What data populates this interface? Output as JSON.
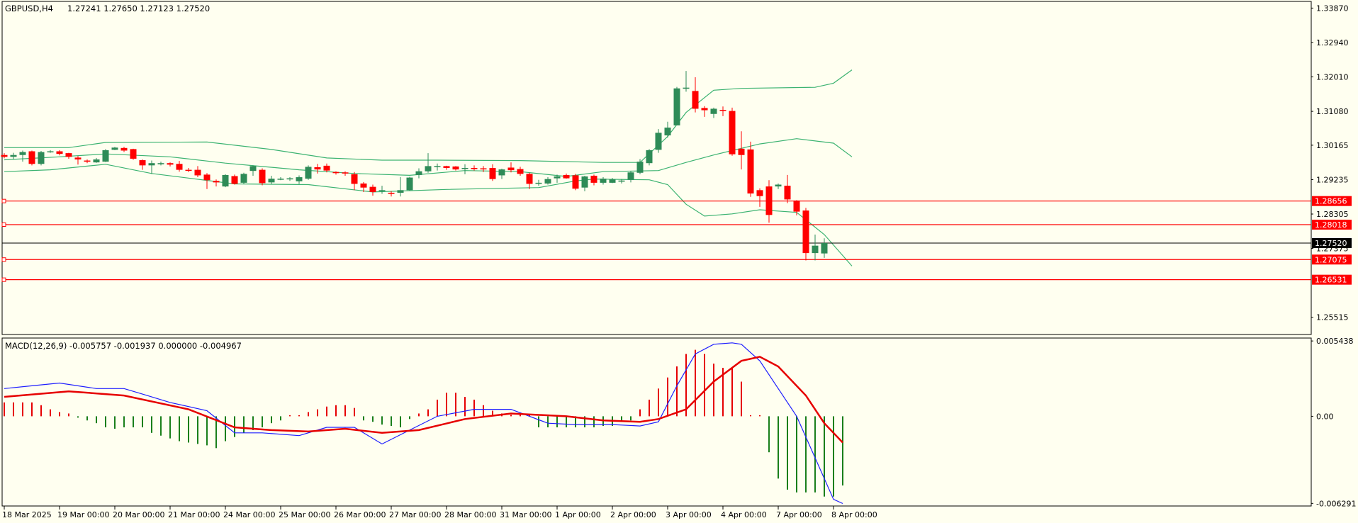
{
  "header": {
    "symbol_tf": "GBPUSD,H4",
    "ohlc": "1.27241 1.27650 1.27123 1.27520"
  },
  "macd_header": "MACD(12,26,9) -0.005757 -0.001937 0.000000 -0.004967",
  "colors": {
    "background": "#fffff0",
    "bull": "#2e8b57",
    "bear": "#ff0000",
    "bands": "#3cb371",
    "level": "#ff0000",
    "macd_line": "#1e1eff",
    "signal_line": "#e60000",
    "hist_pos": "#e60000",
    "hist_neg": "#1a7f1a"
  },
  "price_axis": {
    "ticks": [
      "1.33870",
      "1.32940",
      "1.32010",
      "1.31080",
      "1.30165",
      "1.29235",
      "1.28305",
      "1.27375",
      "1.25515"
    ],
    "levels": [
      "1.28656",
      "1.28018",
      "1.27075",
      "1.26531"
    ],
    "current": "1.27520"
  },
  "macd_axis": {
    "ticks": [
      "0.005438",
      "0.00",
      "-0.006291"
    ]
  },
  "time_axis": [
    "18 Mar 2025",
    "19 Mar 00:00",
    "20 Mar 00:00",
    "21 Mar 00:00",
    "24 Mar 00:00",
    "25 Mar 00:00",
    "26 Mar 00:00",
    "27 Mar 00:00",
    "28 Mar 00:00",
    "31 Mar 00:00",
    "1 Apr 00:00",
    "2 Apr 00:00",
    "3 Apr 00:00",
    "4 Apr 00:00",
    "7 Apr 00:00",
    "8 Apr 00:00"
  ],
  "chart_data": [
    {
      "type": "candlestick",
      "symbol": "GBPUSD",
      "timeframe": "H4",
      "ylim": [
        1.2505,
        1.3405
      ],
      "candles": [
        {
          "o": 1.299,
          "h": 1.2995,
          "l": 1.2981,
          "c": 1.2985
        },
        {
          "o": 1.2985,
          "h": 1.2996,
          "l": 1.2978,
          "c": 1.299
        },
        {
          "o": 1.299,
          "h": 1.3002,
          "l": 1.2972,
          "c": 1.2998
        },
        {
          "o": 1.3,
          "h": 1.3002,
          "l": 1.2962,
          "c": 1.2966
        },
        {
          "o": 1.2966,
          "h": 1.3001,
          "l": 1.2962,
          "c": 1.2998
        },
        {
          "o": 1.2999,
          "h": 1.3003,
          "l": 1.2996,
          "c": 1.3
        },
        {
          "o": 1.3,
          "h": 1.3003,
          "l": 1.2989,
          "c": 1.2993
        },
        {
          "o": 1.2995,
          "h": 1.2996,
          "l": 1.298,
          "c": 1.2985
        },
        {
          "o": 1.2983,
          "h": 1.2987,
          "l": 1.2964,
          "c": 1.2978
        },
        {
          "o": 1.2975,
          "h": 1.2978,
          "l": 1.2968,
          "c": 1.2972
        },
        {
          "o": 1.297,
          "h": 1.2982,
          "l": 1.2969,
          "c": 1.2978
        },
        {
          "o": 1.2972,
          "h": 1.3006,
          "l": 1.2971,
          "c": 1.3003
        },
        {
          "o": 1.3004,
          "h": 1.3012,
          "l": 1.3003,
          "c": 1.301
        },
        {
          "o": 1.3009,
          "h": 1.3012,
          "l": 1.2998,
          "c": 1.3002
        },
        {
          "o": 1.3006,
          "h": 1.3007,
          "l": 1.2977,
          "c": 1.298
        },
        {
          "o": 1.2976,
          "h": 1.2978,
          "l": 1.295,
          "c": 1.2962
        },
        {
          "o": 1.2962,
          "h": 1.2975,
          "l": 1.2939,
          "c": 1.2968
        },
        {
          "o": 1.2965,
          "h": 1.2972,
          "l": 1.2962,
          "c": 1.2968
        },
        {
          "o": 1.2968,
          "h": 1.297,
          "l": 1.2959,
          "c": 1.2964
        },
        {
          "o": 1.2966,
          "h": 1.2974,
          "l": 1.2945,
          "c": 1.295
        },
        {
          "o": 1.295,
          "h": 1.2955,
          "l": 1.2944,
          "c": 1.2948
        },
        {
          "o": 1.295,
          "h": 1.296,
          "l": 1.293,
          "c": 1.2935
        },
        {
          "o": 1.2937,
          "h": 1.2941,
          "l": 1.2898,
          "c": 1.2922
        },
        {
          "o": 1.292,
          "h": 1.2924,
          "l": 1.2905,
          "c": 1.2916
        },
        {
          "o": 1.2905,
          "h": 1.2938,
          "l": 1.2903,
          "c": 1.2936
        },
        {
          "o": 1.2933,
          "h": 1.2937,
          "l": 1.291,
          "c": 1.2912
        },
        {
          "o": 1.2915,
          "h": 1.2942,
          "l": 1.2912,
          "c": 1.2939
        },
        {
          "o": 1.2947,
          "h": 1.2962,
          "l": 1.2934,
          "c": 1.296
        },
        {
          "o": 1.295,
          "h": 1.2954,
          "l": 1.2908,
          "c": 1.2914
        },
        {
          "o": 1.2916,
          "h": 1.2934,
          "l": 1.2912,
          "c": 1.2926
        },
        {
          "o": 1.2925,
          "h": 1.293,
          "l": 1.2922,
          "c": 1.2926
        },
        {
          "o": 1.2926,
          "h": 1.293,
          "l": 1.292,
          "c": 1.2927
        },
        {
          "o": 1.2919,
          "h": 1.2935,
          "l": 1.2912,
          "c": 1.293
        },
        {
          "o": 1.2926,
          "h": 1.2962,
          "l": 1.2923,
          "c": 1.2958
        },
        {
          "o": 1.2957,
          "h": 1.2966,
          "l": 1.294,
          "c": 1.2951
        },
        {
          "o": 1.2961,
          "h": 1.2967,
          "l": 1.2943,
          "c": 1.2948
        },
        {
          "o": 1.2944,
          "h": 1.2946,
          "l": 1.2937,
          "c": 1.2941
        },
        {
          "o": 1.2943,
          "h": 1.2946,
          "l": 1.2934,
          "c": 1.294
        },
        {
          "o": 1.2938,
          "h": 1.2944,
          "l": 1.2895,
          "c": 1.2912
        },
        {
          "o": 1.2913,
          "h": 1.2917,
          "l": 1.289,
          "c": 1.2902
        },
        {
          "o": 1.2904,
          "h": 1.291,
          "l": 1.288,
          "c": 1.289
        },
        {
          "o": 1.2894,
          "h": 1.2907,
          "l": 1.2885,
          "c": 1.2895
        },
        {
          "o": 1.2888,
          "h": 1.2892,
          "l": 1.2878,
          "c": 1.2885
        },
        {
          "o": 1.2888,
          "h": 1.293,
          "l": 1.2878,
          "c": 1.2895
        },
        {
          "o": 1.2895,
          "h": 1.2931,
          "l": 1.2893,
          "c": 1.2929
        },
        {
          "o": 1.2936,
          "h": 1.2954,
          "l": 1.2927,
          "c": 1.2946
        },
        {
          "o": 1.2946,
          "h": 1.2995,
          "l": 1.2942,
          "c": 1.296
        },
        {
          "o": 1.296,
          "h": 1.2967,
          "l": 1.2948,
          "c": 1.296
        },
        {
          "o": 1.296,
          "h": 1.2961,
          "l": 1.295,
          "c": 1.2955
        },
        {
          "o": 1.2959,
          "h": 1.296,
          "l": 1.2948,
          "c": 1.2951
        },
        {
          "o": 1.2953,
          "h": 1.2965,
          "l": 1.2938,
          "c": 1.2955
        },
        {
          "o": 1.2955,
          "h": 1.2962,
          "l": 1.2948,
          "c": 1.2952
        },
        {
          "o": 1.2954,
          "h": 1.296,
          "l": 1.2944,
          "c": 1.2953
        },
        {
          "o": 1.2955,
          "h": 1.2965,
          "l": 1.292,
          "c": 1.2925
        },
        {
          "o": 1.2935,
          "h": 1.2953,
          "l": 1.2925,
          "c": 1.2951
        },
        {
          "o": 1.2956,
          "h": 1.297,
          "l": 1.2943,
          "c": 1.2949
        },
        {
          "o": 1.2952,
          "h": 1.2958,
          "l": 1.2934,
          "c": 1.2939
        },
        {
          "o": 1.2939,
          "h": 1.2942,
          "l": 1.2898,
          "c": 1.2912
        },
        {
          "o": 1.2915,
          "h": 1.2923,
          "l": 1.2907,
          "c": 1.2915
        },
        {
          "o": 1.2913,
          "h": 1.293,
          "l": 1.291,
          "c": 1.2925
        },
        {
          "o": 1.2927,
          "h": 1.2937,
          "l": 1.2915,
          "c": 1.2932
        },
        {
          "o": 1.2936,
          "h": 1.294,
          "l": 1.2926,
          "c": 1.2927
        },
        {
          "o": 1.2935,
          "h": 1.2939,
          "l": 1.2895,
          "c": 1.2899
        },
        {
          "o": 1.2902,
          "h": 1.2934,
          "l": 1.2892,
          "c": 1.2932
        },
        {
          "o": 1.2934,
          "h": 1.2937,
          "l": 1.2908,
          "c": 1.2915
        },
        {
          "o": 1.2915,
          "h": 1.293,
          "l": 1.291,
          "c": 1.2926
        },
        {
          "o": 1.2915,
          "h": 1.2928,
          "l": 1.2914,
          "c": 1.2924
        },
        {
          "o": 1.2918,
          "h": 1.2925,
          "l": 1.2913,
          "c": 1.2921
        },
        {
          "o": 1.2923,
          "h": 1.2947,
          "l": 1.2916,
          "c": 1.2943
        },
        {
          "o": 1.2942,
          "h": 1.2979,
          "l": 1.2938,
          "c": 1.2972
        },
        {
          "o": 1.2968,
          "h": 1.3006,
          "l": 1.2962,
          "c": 1.3003
        },
        {
          "o": 1.3004,
          "h": 1.306,
          "l": 1.2996,
          "c": 1.305
        },
        {
          "o": 1.3043,
          "h": 1.308,
          "l": 1.3037,
          "c": 1.3064
        },
        {
          "o": 1.307,
          "h": 1.3174,
          "l": 1.307,
          "c": 1.317
        },
        {
          "o": 1.317,
          "h": 1.3217,
          "l": 1.3161,
          "c": 1.3172
        },
        {
          "o": 1.3163,
          "h": 1.32,
          "l": 1.3105,
          "c": 1.3115
        },
        {
          "o": 1.3117,
          "h": 1.3122,
          "l": 1.3093,
          "c": 1.3111
        },
        {
          "o": 1.3101,
          "h": 1.3118,
          "l": 1.309,
          "c": 1.3115
        },
        {
          "o": 1.3112,
          "h": 1.3121,
          "l": 1.3095,
          "c": 1.311
        },
        {
          "o": 1.3109,
          "h": 1.3118,
          "l": 1.2988,
          "c": 1.2992
        },
        {
          "o": 1.3007,
          "h": 1.3054,
          "l": 1.2951,
          "c": 1.299
        },
        {
          "o": 1.3005,
          "h": 1.3026,
          "l": 1.2877,
          "c": 1.2886
        },
        {
          "o": 1.2895,
          "h": 1.29,
          "l": 1.285,
          "c": 1.2879
        },
        {
          "o": 1.2905,
          "h": 1.2922,
          "l": 1.2807,
          "c": 1.2828
        },
        {
          "o": 1.2905,
          "h": 1.2913,
          "l": 1.2898,
          "c": 1.291
        },
        {
          "o": 1.2907,
          "h": 1.2936,
          "l": 1.286,
          "c": 1.287
        },
        {
          "o": 1.2867,
          "h": 1.2868,
          "l": 1.2827,
          "c": 1.2837
        },
        {
          "o": 1.284,
          "h": 1.2847,
          "l": 1.2705,
          "c": 1.2725
        },
        {
          "o": 1.2725,
          "h": 1.2775,
          "l": 1.2705,
          "c": 1.2745
        },
        {
          "o": 1.2724,
          "h": 1.2765,
          "l": 1.2712,
          "c": 1.2752
        }
      ],
      "bollinger": {
        "upper_pts": [
          [
            0,
            1.301
          ],
          [
            7,
            1.301
          ],
          [
            11,
            1.3024
          ],
          [
            22,
            1.3025
          ],
          [
            29,
            1.3005
          ],
          [
            35,
            1.2982
          ],
          [
            41,
            1.2976
          ],
          [
            47,
            1.2976
          ],
          [
            56,
            1.2975
          ],
          [
            65,
            1.297
          ],
          [
            69,
            1.297
          ],
          [
            72,
            1.304
          ],
          [
            74,
            1.3105
          ],
          [
            77,
            1.3165
          ],
          [
            80,
            1.317
          ],
          [
            88,
            1.3173
          ],
          [
            90,
            1.3184
          ],
          [
            92,
            1.322
          ]
        ],
        "middle_pts": [
          [
            0,
            1.2977
          ],
          [
            6,
            1.2985
          ],
          [
            11,
            1.2993
          ],
          [
            18,
            1.2985
          ],
          [
            24,
            1.2968
          ],
          [
            32,
            1.295
          ],
          [
            38,
            1.294
          ],
          [
            44,
            1.2935
          ],
          [
            50,
            1.2948
          ],
          [
            56,
            1.2945
          ],
          [
            61,
            1.2932
          ],
          [
            65,
            1.2945
          ],
          [
            71,
            1.2948
          ],
          [
            74,
            1.297
          ],
          [
            77,
            1.299
          ],
          [
            82,
            1.302
          ],
          [
            86,
            1.3034
          ],
          [
            90,
            1.3022
          ],
          [
            92,
            1.2985
          ]
        ],
        "lower_pts": [
          [
            0,
            1.2945
          ],
          [
            5,
            1.295
          ],
          [
            11,
            1.2965
          ],
          [
            16,
            1.294
          ],
          [
            25,
            1.2912
          ],
          [
            33,
            1.291
          ],
          [
            40,
            1.289
          ],
          [
            48,
            1.2897
          ],
          [
            58,
            1.2902
          ],
          [
            62,
            1.292
          ],
          [
            64,
            1.2925
          ],
          [
            70,
            1.2923
          ],
          [
            72,
            1.291
          ],
          [
            74,
            1.2857
          ],
          [
            76,
            1.2825
          ],
          [
            79,
            1.2831
          ],
          [
            82,
            1.2842
          ],
          [
            86,
            1.2835
          ],
          [
            89,
            1.2775
          ],
          [
            92,
            1.269
          ]
        ]
      },
      "levels": [
        1.28656,
        1.28018,
        1.27075,
        1.26531
      ],
      "current_price": 1.2752
    },
    {
      "type": "macd",
      "params": "MACD(12,26,9)",
      "ylim": [
        -0.00648,
        0.00565
      ],
      "histogram": [
        0.001,
        0.001,
        0.001,
        0.001,
        0.0008,
        0.0005,
        0.0003,
        0.0002,
        -0.0001,
        -0.0003,
        -0.0005,
        -0.0008,
        -0.0009,
        -0.0008,
        -0.0008,
        -0.0008,
        -0.0012,
        -0.0014,
        -0.0016,
        -0.0018,
        -0.0019,
        -0.002,
        -0.0021,
        -0.0023,
        -0.0018,
        -0.0015,
        -0.0012,
        -0.001,
        -0.0008,
        -0.0005,
        -0.0003,
        0.0,
        0.0,
        0.0003,
        0.0005,
        0.0007,
        0.0008,
        0.0008,
        0.0006,
        -0.0003,
        -0.0004,
        -0.0006,
        -0.0007,
        -0.0008,
        -0.0002,
        0.0002,
        0.0005,
        0.0012,
        0.0017,
        0.0017,
        0.0014,
        0.0012,
        0.0008,
        0.0004,
        0.0002,
        0.0001,
        0.0001,
        0.0001,
        -0.0008,
        -0.0008,
        -0.0008,
        -0.0008,
        -0.0008,
        -0.0008,
        -0.0008,
        -0.0007,
        -0.0007,
        -0.0003,
        -0.0003,
        0.0005,
        0.0012,
        0.002,
        0.0028,
        0.0036,
        0.0045,
        0.0048,
        0.0045,
        0.0038,
        0.0035,
        0.0035,
        0.0025,
        0.0,
        0.0,
        -0.0026,
        -0.0045,
        -0.0053,
        -0.0055,
        -0.0055,
        -0.0055,
        -0.0058,
        -0.0058,
        -0.005
      ],
      "macd_pts": [
        [
          0,
          0.002
        ],
        [
          3,
          0.0022
        ],
        [
          6,
          0.0024
        ],
        [
          10,
          0.002
        ],
        [
          13,
          0.002
        ],
        [
          15,
          0.0016
        ],
        [
          18,
          0.001
        ],
        [
          22,
          0.0004
        ],
        [
          25,
          -0.0012
        ],
        [
          28,
          -0.0012
        ],
        [
          32,
          -0.0014
        ],
        [
          35,
          -0.0008
        ],
        [
          38,
          -0.0008
        ],
        [
          41,
          -0.002
        ],
        [
          44,
          -0.001
        ],
        [
          47,
          0.0
        ],
        [
          51,
          0.0005
        ],
        [
          55,
          0.0005
        ],
        [
          59,
          -0.0005
        ],
        [
          62,
          -0.0006
        ],
        [
          66,
          -0.0006
        ],
        [
          69,
          -0.0007
        ],
        [
          71,
          -0.0004
        ],
        [
          73,
          0.0022
        ],
        [
          75,
          0.0045
        ],
        [
          77,
          0.0052
        ],
        [
          79,
          0.0053
        ],
        [
          80,
          0.0052
        ],
        [
          82,
          0.004
        ],
        [
          84,
          0.002
        ],
        [
          86,
          0.0
        ],
        [
          88,
          -0.003
        ],
        [
          90,
          -0.006
        ],
        [
          91,
          -0.0063
        ]
      ],
      "signal_pts": [
        [
          0,
          0.0014
        ],
        [
          7,
          0.0018
        ],
        [
          13,
          0.0015
        ],
        [
          20,
          0.0005
        ],
        [
          25,
          -0.0008
        ],
        [
          29,
          -0.001
        ],
        [
          33,
          -0.0011
        ],
        [
          37,
          -0.0009
        ],
        [
          41,
          -0.0012
        ],
        [
          45,
          -0.001
        ],
        [
          50,
          -0.0002
        ],
        [
          55,
          0.0002
        ],
        [
          61,
          0.0
        ],
        [
          65,
          -0.0003
        ],
        [
          69,
          -0.0004
        ],
        [
          71,
          -0.0002
        ],
        [
          74,
          0.0005
        ],
        [
          77,
          0.0025
        ],
        [
          80,
          0.004
        ],
        [
          82,
          0.0043
        ],
        [
          84,
          0.0036
        ],
        [
          87,
          0.0015
        ],
        [
          89,
          -0.0005
        ],
        [
          91,
          -0.0019
        ]
      ]
    }
  ]
}
